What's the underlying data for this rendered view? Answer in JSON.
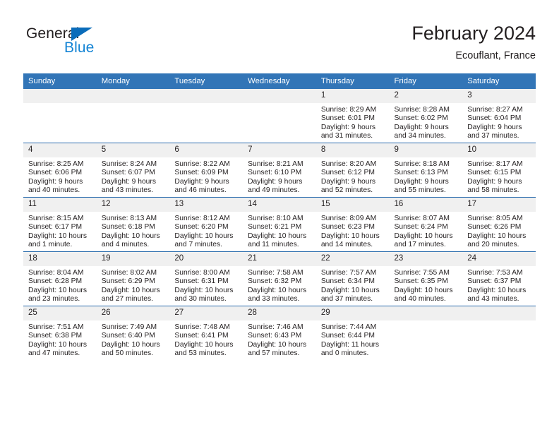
{
  "brand": {
    "name_part1": "General",
    "name_part2": "Blue",
    "triangle_icon": "brand-triangle-icon",
    "blue_accent": "#1283d4",
    "triangle_color": "#0a6cba"
  },
  "header": {
    "title": "February 2024",
    "subtitle": "Ecouflant, France"
  },
  "calendar": {
    "header_bg": "#3275b7",
    "header_text_color": "#ffffff",
    "row_divider_color": "#2a6cad",
    "daynum_band_color": "#f0f0f0",
    "weekdays": [
      "Sunday",
      "Monday",
      "Tuesday",
      "Wednesday",
      "Thursday",
      "Friday",
      "Saturday"
    ],
    "weeks": [
      [
        {
          "day": "",
          "sunrise": "",
          "sunset": "",
          "daylight_line1": "",
          "daylight_line2": ""
        },
        {
          "day": "",
          "sunrise": "",
          "sunset": "",
          "daylight_line1": "",
          "daylight_line2": ""
        },
        {
          "day": "",
          "sunrise": "",
          "sunset": "",
          "daylight_line1": "",
          "daylight_line2": ""
        },
        {
          "day": "",
          "sunrise": "",
          "sunset": "",
          "daylight_line1": "",
          "daylight_line2": ""
        },
        {
          "day": "1",
          "sunrise": "Sunrise: 8:29 AM",
          "sunset": "Sunset: 6:01 PM",
          "daylight_line1": "Daylight: 9 hours",
          "daylight_line2": "and 31 minutes."
        },
        {
          "day": "2",
          "sunrise": "Sunrise: 8:28 AM",
          "sunset": "Sunset: 6:02 PM",
          "daylight_line1": "Daylight: 9 hours",
          "daylight_line2": "and 34 minutes."
        },
        {
          "day": "3",
          "sunrise": "Sunrise: 8:27 AM",
          "sunset": "Sunset: 6:04 PM",
          "daylight_line1": "Daylight: 9 hours",
          "daylight_line2": "and 37 minutes."
        }
      ],
      [
        {
          "day": "4",
          "sunrise": "Sunrise: 8:25 AM",
          "sunset": "Sunset: 6:06 PM",
          "daylight_line1": "Daylight: 9 hours",
          "daylight_line2": "and 40 minutes."
        },
        {
          "day": "5",
          "sunrise": "Sunrise: 8:24 AM",
          "sunset": "Sunset: 6:07 PM",
          "daylight_line1": "Daylight: 9 hours",
          "daylight_line2": "and 43 minutes."
        },
        {
          "day": "6",
          "sunrise": "Sunrise: 8:22 AM",
          "sunset": "Sunset: 6:09 PM",
          "daylight_line1": "Daylight: 9 hours",
          "daylight_line2": "and 46 minutes."
        },
        {
          "day": "7",
          "sunrise": "Sunrise: 8:21 AM",
          "sunset": "Sunset: 6:10 PM",
          "daylight_line1": "Daylight: 9 hours",
          "daylight_line2": "and 49 minutes."
        },
        {
          "day": "8",
          "sunrise": "Sunrise: 8:20 AM",
          "sunset": "Sunset: 6:12 PM",
          "daylight_line1": "Daylight: 9 hours",
          "daylight_line2": "and 52 minutes."
        },
        {
          "day": "9",
          "sunrise": "Sunrise: 8:18 AM",
          "sunset": "Sunset: 6:13 PM",
          "daylight_line1": "Daylight: 9 hours",
          "daylight_line2": "and 55 minutes."
        },
        {
          "day": "10",
          "sunrise": "Sunrise: 8:17 AM",
          "sunset": "Sunset: 6:15 PM",
          "daylight_line1": "Daylight: 9 hours",
          "daylight_line2": "and 58 minutes."
        }
      ],
      [
        {
          "day": "11",
          "sunrise": "Sunrise: 8:15 AM",
          "sunset": "Sunset: 6:17 PM",
          "daylight_line1": "Daylight: 10 hours",
          "daylight_line2": "and 1 minute."
        },
        {
          "day": "12",
          "sunrise": "Sunrise: 8:13 AM",
          "sunset": "Sunset: 6:18 PM",
          "daylight_line1": "Daylight: 10 hours",
          "daylight_line2": "and 4 minutes."
        },
        {
          "day": "13",
          "sunrise": "Sunrise: 8:12 AM",
          "sunset": "Sunset: 6:20 PM",
          "daylight_line1": "Daylight: 10 hours",
          "daylight_line2": "and 7 minutes."
        },
        {
          "day": "14",
          "sunrise": "Sunrise: 8:10 AM",
          "sunset": "Sunset: 6:21 PM",
          "daylight_line1": "Daylight: 10 hours",
          "daylight_line2": "and 11 minutes."
        },
        {
          "day": "15",
          "sunrise": "Sunrise: 8:09 AM",
          "sunset": "Sunset: 6:23 PM",
          "daylight_line1": "Daylight: 10 hours",
          "daylight_line2": "and 14 minutes."
        },
        {
          "day": "16",
          "sunrise": "Sunrise: 8:07 AM",
          "sunset": "Sunset: 6:24 PM",
          "daylight_line1": "Daylight: 10 hours",
          "daylight_line2": "and 17 minutes."
        },
        {
          "day": "17",
          "sunrise": "Sunrise: 8:05 AM",
          "sunset": "Sunset: 6:26 PM",
          "daylight_line1": "Daylight: 10 hours",
          "daylight_line2": "and 20 minutes."
        }
      ],
      [
        {
          "day": "18",
          "sunrise": "Sunrise: 8:04 AM",
          "sunset": "Sunset: 6:28 PM",
          "daylight_line1": "Daylight: 10 hours",
          "daylight_line2": "and 23 minutes."
        },
        {
          "day": "19",
          "sunrise": "Sunrise: 8:02 AM",
          "sunset": "Sunset: 6:29 PM",
          "daylight_line1": "Daylight: 10 hours",
          "daylight_line2": "and 27 minutes."
        },
        {
          "day": "20",
          "sunrise": "Sunrise: 8:00 AM",
          "sunset": "Sunset: 6:31 PM",
          "daylight_line1": "Daylight: 10 hours",
          "daylight_line2": "and 30 minutes."
        },
        {
          "day": "21",
          "sunrise": "Sunrise: 7:58 AM",
          "sunset": "Sunset: 6:32 PM",
          "daylight_line1": "Daylight: 10 hours",
          "daylight_line2": "and 33 minutes."
        },
        {
          "day": "22",
          "sunrise": "Sunrise: 7:57 AM",
          "sunset": "Sunset: 6:34 PM",
          "daylight_line1": "Daylight: 10 hours",
          "daylight_line2": "and 37 minutes."
        },
        {
          "day": "23",
          "sunrise": "Sunrise: 7:55 AM",
          "sunset": "Sunset: 6:35 PM",
          "daylight_line1": "Daylight: 10 hours",
          "daylight_line2": "and 40 minutes."
        },
        {
          "day": "24",
          "sunrise": "Sunrise: 7:53 AM",
          "sunset": "Sunset: 6:37 PM",
          "daylight_line1": "Daylight: 10 hours",
          "daylight_line2": "and 43 minutes."
        }
      ],
      [
        {
          "day": "25",
          "sunrise": "Sunrise: 7:51 AM",
          "sunset": "Sunset: 6:38 PM",
          "daylight_line1": "Daylight: 10 hours",
          "daylight_line2": "and 47 minutes."
        },
        {
          "day": "26",
          "sunrise": "Sunrise: 7:49 AM",
          "sunset": "Sunset: 6:40 PM",
          "daylight_line1": "Daylight: 10 hours",
          "daylight_line2": "and 50 minutes."
        },
        {
          "day": "27",
          "sunrise": "Sunrise: 7:48 AM",
          "sunset": "Sunset: 6:41 PM",
          "daylight_line1": "Daylight: 10 hours",
          "daylight_line2": "and 53 minutes."
        },
        {
          "day": "28",
          "sunrise": "Sunrise: 7:46 AM",
          "sunset": "Sunset: 6:43 PM",
          "daylight_line1": "Daylight: 10 hours",
          "daylight_line2": "and 57 minutes."
        },
        {
          "day": "29",
          "sunrise": "Sunrise: 7:44 AM",
          "sunset": "Sunset: 6:44 PM",
          "daylight_line1": "Daylight: 11 hours",
          "daylight_line2": "and 0 minutes."
        },
        {
          "day": "",
          "sunrise": "",
          "sunset": "",
          "daylight_line1": "",
          "daylight_line2": ""
        },
        {
          "day": "",
          "sunrise": "",
          "sunset": "",
          "daylight_line1": "",
          "daylight_line2": ""
        }
      ]
    ]
  }
}
